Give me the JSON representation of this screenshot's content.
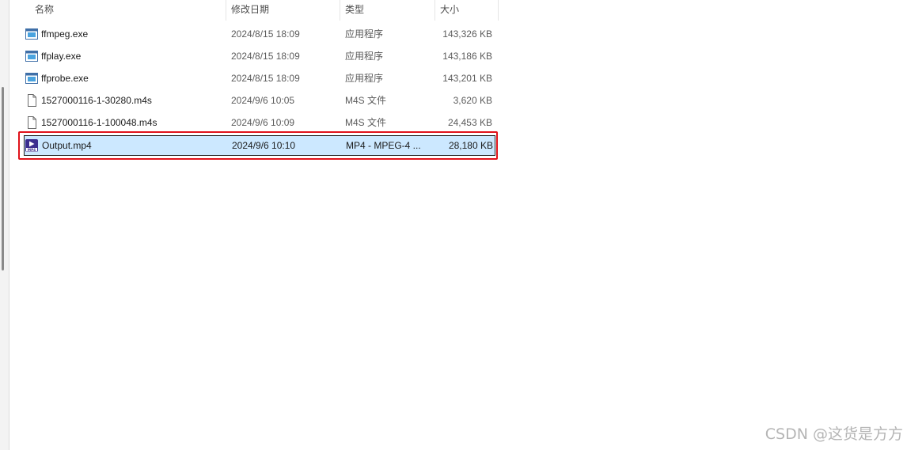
{
  "columns": {
    "name": "名称",
    "date": "修改日期",
    "type": "类型",
    "size": "大小"
  },
  "sort_arrow": "^",
  "files": [
    {
      "name": "ffmpeg.exe",
      "date": "2024/8/15 18:09",
      "type": "应用程序",
      "size": "143,326 KB",
      "icon": "exe-icon"
    },
    {
      "name": "ffplay.exe",
      "date": "2024/8/15 18:09",
      "type": "应用程序",
      "size": "143,186 KB",
      "icon": "exe-icon"
    },
    {
      "name": "ffprobe.exe",
      "date": "2024/8/15 18:09",
      "type": "应用程序",
      "size": "143,201 KB",
      "icon": "exe-icon"
    },
    {
      "name": "1527000116-1-30280.m4s",
      "date": "2024/9/6 10:05",
      "type": "M4S 文件",
      "size": "3,620 KB",
      "icon": "file-icon"
    },
    {
      "name": "1527000116-1-100048.m4s",
      "date": "2024/9/6 10:09",
      "type": "M4S 文件",
      "size": "24,453 KB",
      "icon": "file-icon"
    },
    {
      "name": "Output.mp4",
      "date": "2024/9/6 10:10",
      "type": "MP4 - MPEG-4 ...",
      "size": "28,180 KB",
      "icon": "mp4-video-icon",
      "selected": true
    }
  ],
  "watermark": "CSDN @这货是方方",
  "colors": {
    "selection": "#cce8ff",
    "highlight_border": "#e0121a"
  }
}
